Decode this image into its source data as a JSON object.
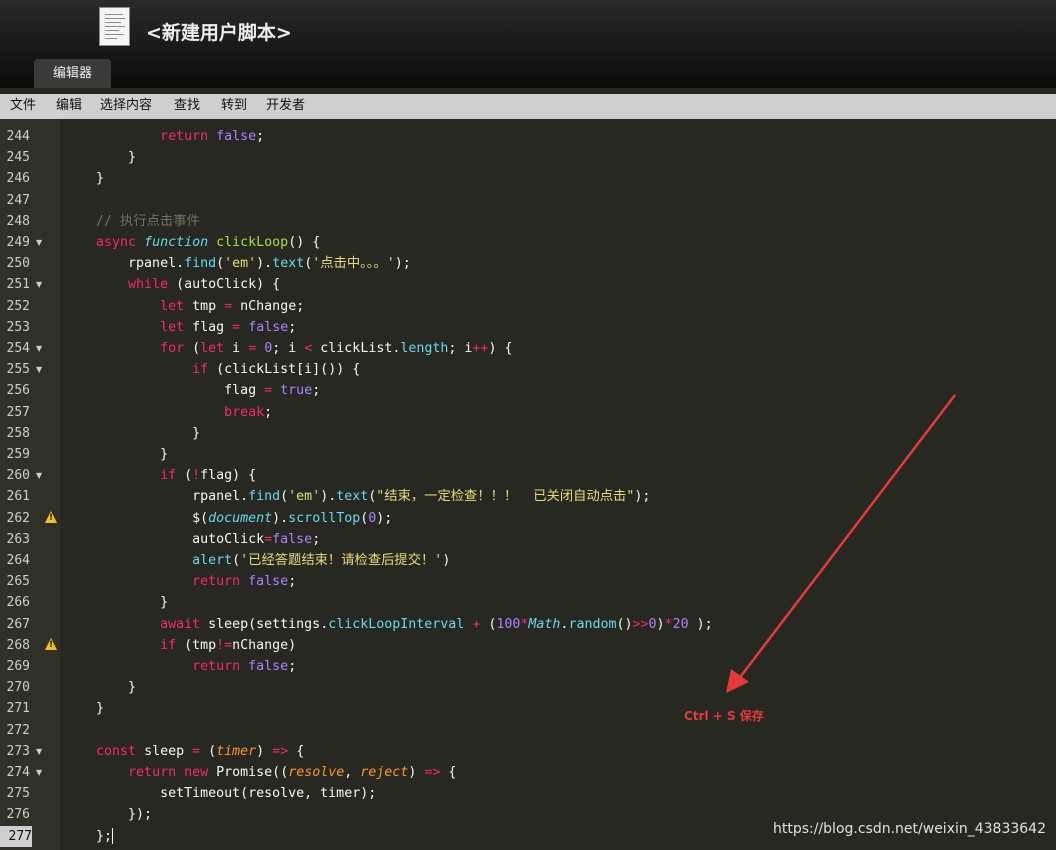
{
  "window": {
    "title": "<新建用户脚本>"
  },
  "tabs": [
    {
      "label": "编辑器"
    }
  ],
  "menu": [
    "文件",
    "编辑",
    "选择内容",
    "查找",
    "转到",
    "开发者"
  ],
  "editor": {
    "current_line": "277",
    "gutter": [
      {
        "n": "244",
        "fold": "",
        "warn": false
      },
      {
        "n": "245",
        "fold": "",
        "warn": false
      },
      {
        "n": "246",
        "fold": "",
        "warn": false
      },
      {
        "n": "247",
        "fold": "",
        "warn": false
      },
      {
        "n": "248",
        "fold": "",
        "warn": false
      },
      {
        "n": "249",
        "fold": "▼",
        "warn": false
      },
      {
        "n": "250",
        "fold": "",
        "warn": false
      },
      {
        "n": "251",
        "fold": "▼",
        "warn": false
      },
      {
        "n": "252",
        "fold": "",
        "warn": false
      },
      {
        "n": "253",
        "fold": "",
        "warn": false
      },
      {
        "n": "254",
        "fold": "▼",
        "warn": false
      },
      {
        "n": "255",
        "fold": "▼",
        "warn": false
      },
      {
        "n": "256",
        "fold": "",
        "warn": false
      },
      {
        "n": "257",
        "fold": "",
        "warn": false
      },
      {
        "n": "258",
        "fold": "",
        "warn": false
      },
      {
        "n": "259",
        "fold": "",
        "warn": false
      },
      {
        "n": "260",
        "fold": "▼",
        "warn": false
      },
      {
        "n": "261",
        "fold": "",
        "warn": false
      },
      {
        "n": "262",
        "fold": "",
        "warn": true
      },
      {
        "n": "263",
        "fold": "",
        "warn": false
      },
      {
        "n": "264",
        "fold": "",
        "warn": false
      },
      {
        "n": "265",
        "fold": "",
        "warn": false
      },
      {
        "n": "266",
        "fold": "",
        "warn": false
      },
      {
        "n": "267",
        "fold": "",
        "warn": false
      },
      {
        "n": "268",
        "fold": "",
        "warn": true
      },
      {
        "n": "269",
        "fold": "",
        "warn": false
      },
      {
        "n": "270",
        "fold": "",
        "warn": false
      },
      {
        "n": "271",
        "fold": "",
        "warn": false
      },
      {
        "n": "272",
        "fold": "",
        "warn": false
      },
      {
        "n": "273",
        "fold": "▼",
        "warn": false
      },
      {
        "n": "274",
        "fold": "▼",
        "warn": false
      },
      {
        "n": "275",
        "fold": "",
        "warn": false
      },
      {
        "n": "276",
        "fold": "",
        "warn": false
      },
      {
        "n": "277",
        "fold": "",
        "warn": false
      }
    ],
    "lines": [
      [
        [
          "            ",
          ""
        ],
        [
          "return",
          "k"
        ],
        [
          " ",
          ""
        ],
        [
          "false",
          "b"
        ],
        [
          ";",
          ""
        ]
      ],
      [
        [
          "        }",
          ""
        ]
      ],
      [
        [
          "    }",
          ""
        ]
      ],
      [
        [
          "",
          ""
        ]
      ],
      [
        [
          "    ",
          ""
        ],
        [
          "// 执行点击事件",
          "c"
        ]
      ],
      [
        [
          "    ",
          ""
        ],
        [
          "async",
          "k"
        ],
        [
          " ",
          ""
        ],
        [
          "function",
          "st"
        ],
        [
          " ",
          ""
        ],
        [
          "clickLoop",
          "f"
        ],
        [
          "() {",
          ""
        ]
      ],
      [
        [
          "        rpanel.",
          ""
        ],
        [
          "find",
          "m"
        ],
        [
          "(",
          ""
        ],
        [
          "'em'",
          "s"
        ],
        [
          ").",
          ""
        ],
        [
          "text",
          "m"
        ],
        [
          "(",
          ""
        ],
        [
          "'点击中。。。'",
          "s"
        ],
        [
          ");",
          ""
        ]
      ],
      [
        [
          "        ",
          ""
        ],
        [
          "while",
          "k"
        ],
        [
          " (autoClick) {",
          ""
        ]
      ],
      [
        [
          "            ",
          ""
        ],
        [
          "let",
          "k"
        ],
        [
          " tmp ",
          ""
        ],
        [
          "=",
          "k"
        ],
        [
          " nChange;",
          ""
        ]
      ],
      [
        [
          "            ",
          ""
        ],
        [
          "let",
          "k"
        ],
        [
          " flag ",
          ""
        ],
        [
          "=",
          "k"
        ],
        [
          " ",
          ""
        ],
        [
          "false",
          "b"
        ],
        [
          ";",
          ""
        ]
      ],
      [
        [
          "            ",
          ""
        ],
        [
          "for",
          "k"
        ],
        [
          " (",
          ""
        ],
        [
          "let",
          "k"
        ],
        [
          " i ",
          ""
        ],
        [
          "=",
          "k"
        ],
        [
          " ",
          ""
        ],
        [
          "0",
          "b"
        ],
        [
          "; i ",
          ""
        ],
        [
          "<",
          "k"
        ],
        [
          " clickList.",
          ""
        ],
        [
          "length",
          "m"
        ],
        [
          "; i",
          ""
        ],
        [
          "++",
          "k"
        ],
        [
          ") {",
          ""
        ]
      ],
      [
        [
          "                ",
          ""
        ],
        [
          "if",
          "k"
        ],
        [
          " (clickList[i]()) {",
          ""
        ]
      ],
      [
        [
          "                    flag ",
          ""
        ],
        [
          "=",
          "k"
        ],
        [
          " ",
          ""
        ],
        [
          "true",
          "b"
        ],
        [
          ";",
          ""
        ]
      ],
      [
        [
          "                    ",
          ""
        ],
        [
          "break",
          "k"
        ],
        [
          ";",
          ""
        ]
      ],
      [
        [
          "                }",
          ""
        ]
      ],
      [
        [
          "            }",
          ""
        ]
      ],
      [
        [
          "            ",
          ""
        ],
        [
          "if",
          "k"
        ],
        [
          " (",
          ""
        ],
        [
          "!",
          "k"
        ],
        [
          "flag) {",
          ""
        ]
      ],
      [
        [
          "                rpanel.",
          ""
        ],
        [
          "find",
          "m"
        ],
        [
          "(",
          ""
        ],
        [
          "'em'",
          "s"
        ],
        [
          ").",
          ""
        ],
        [
          "text",
          "m"
        ],
        [
          "(",
          ""
        ],
        [
          "\"结束，一定检查！！！  已关闭自动点击\"",
          "s"
        ],
        [
          ");",
          ""
        ]
      ],
      [
        [
          "                $(",
          ""
        ],
        [
          "document",
          "st"
        ],
        [
          ").",
          ""
        ],
        [
          "scrollTop",
          "m"
        ],
        [
          "(",
          ""
        ],
        [
          "0",
          "b"
        ],
        [
          ");",
          ""
        ]
      ],
      [
        [
          "                autoClick",
          ""
        ],
        [
          "=",
          "k"
        ],
        [
          "false",
          "b"
        ],
        [
          ";",
          ""
        ]
      ],
      [
        [
          "                ",
          ""
        ],
        [
          "alert",
          "m"
        ],
        [
          "(",
          ""
        ],
        [
          "'已经答题结束！请检查后提交！'",
          "s"
        ],
        [
          ")",
          ""
        ]
      ],
      [
        [
          "                ",
          ""
        ],
        [
          "return",
          "k"
        ],
        [
          " ",
          ""
        ],
        [
          "false",
          "b"
        ],
        [
          ";",
          ""
        ]
      ],
      [
        [
          "            }",
          ""
        ]
      ],
      [
        [
          "            ",
          ""
        ],
        [
          "await",
          "k"
        ],
        [
          " sleep(settings.",
          ""
        ],
        [
          "clickLoopInterval",
          "m"
        ],
        [
          " ",
          ""
        ],
        [
          "+",
          "k"
        ],
        [
          " (",
          ""
        ],
        [
          "100",
          "b"
        ],
        [
          "*",
          "k"
        ],
        [
          "Math",
          "st"
        ],
        [
          ".",
          ""
        ],
        [
          "random",
          "m"
        ],
        [
          "()",
          ""
        ],
        [
          ">>",
          "k"
        ],
        [
          "0",
          "b"
        ],
        [
          ")",
          ""
        ],
        [
          "*",
          "k"
        ],
        [
          "20",
          "b"
        ],
        [
          " );",
          ""
        ]
      ],
      [
        [
          "            ",
          ""
        ],
        [
          "if",
          "k"
        ],
        [
          " (tmp",
          ""
        ],
        [
          "!=",
          "k"
        ],
        [
          "nChange)",
          ""
        ]
      ],
      [
        [
          "                ",
          ""
        ],
        [
          "return",
          "k"
        ],
        [
          " ",
          ""
        ],
        [
          "false",
          "b"
        ],
        [
          ";",
          ""
        ]
      ],
      [
        [
          "        }",
          ""
        ]
      ],
      [
        [
          "    }",
          ""
        ]
      ],
      [
        [
          "",
          ""
        ]
      ],
      [
        [
          "    ",
          ""
        ],
        [
          "const",
          "k"
        ],
        [
          " sleep ",
          ""
        ],
        [
          "=",
          "k"
        ],
        [
          " (",
          ""
        ],
        [
          "timer",
          "p"
        ],
        [
          ") ",
          ""
        ],
        [
          "=>",
          "k"
        ],
        [
          " {",
          ""
        ]
      ],
      [
        [
          "        ",
          ""
        ],
        [
          "return",
          "k"
        ],
        [
          " ",
          ""
        ],
        [
          "new",
          "k"
        ],
        [
          " Promise((",
          ""
        ],
        [
          "resolve",
          "p"
        ],
        [
          ", ",
          ""
        ],
        [
          "reject",
          "p"
        ],
        [
          ") ",
          ""
        ],
        [
          "=>",
          "k"
        ],
        [
          " {",
          ""
        ]
      ],
      [
        [
          "            setTimeout(resolve, timer);",
          ""
        ]
      ],
      [
        [
          "        });",
          ""
        ]
      ],
      [
        [
          "    };",
          ""
        ]
      ]
    ]
  },
  "annotation": {
    "text": "Ctrl + S 保存",
    "color": "#e53a3a"
  },
  "watermark": "https://blog.csdn.net/weixin_43833642"
}
